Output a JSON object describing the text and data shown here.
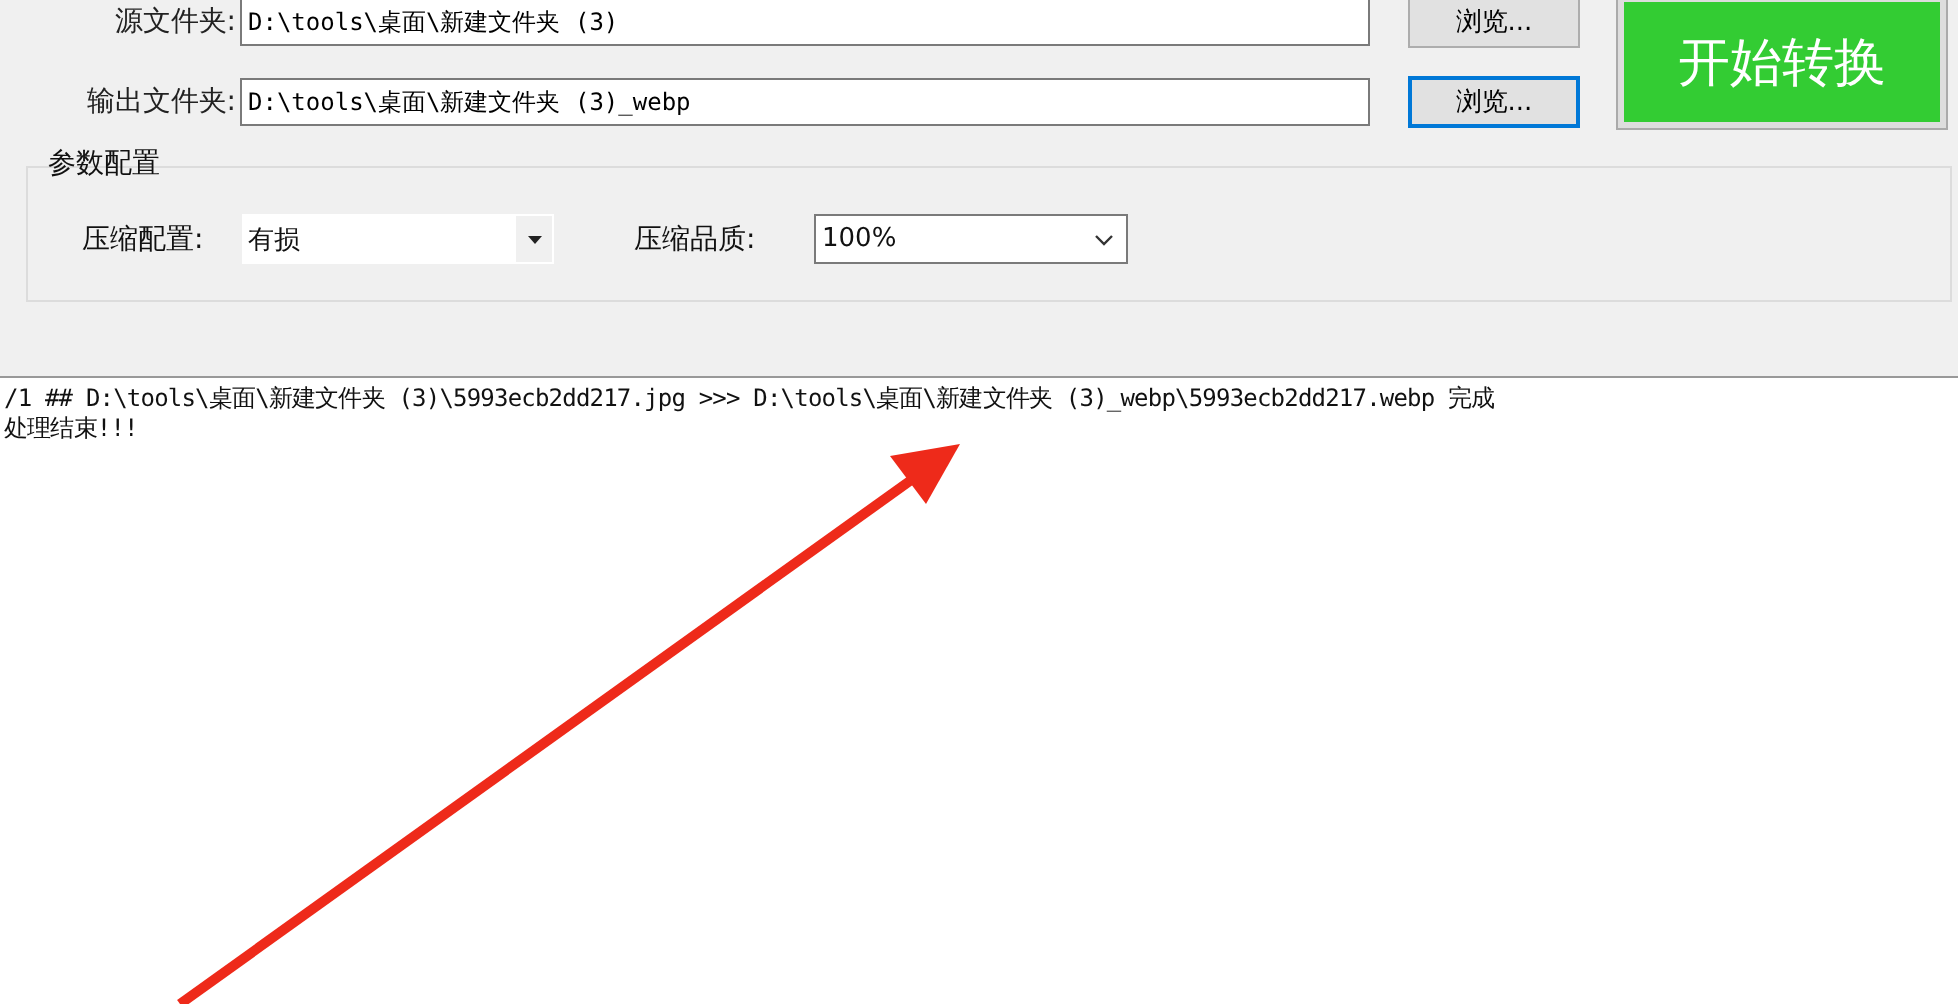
{
  "folders": [
    {
      "label": "源文件夹:",
      "value": "D:\\tools\\桌面\\新建文件夹 (3)",
      "browse": {
        "label": "浏览...",
        "focused": false
      }
    },
    {
      "label": "输出文件夹:",
      "value": "D:\\tools\\桌面\\新建文件夹 (3)_webp",
      "browse": {
        "label": "浏览...",
        "focused": true
      }
    }
  ],
  "start_button": "开始转换",
  "params": {
    "title": "参数配置",
    "fields": [
      {
        "kind": "flat",
        "label": "压缩配置:",
        "value": "有损"
      },
      {
        "kind": "combo",
        "label": "压缩品质:",
        "value": "100%"
      }
    ]
  },
  "log": [
    "/1 ## D:\\tools\\桌面\\新建文件夹 (3)\\5993ecb2dd217.jpg >>> D:\\tools\\桌面\\新建文件夹 (3)_webp\\5993ecb2dd217.webp 完成",
    "处理结束!!!"
  ]
}
